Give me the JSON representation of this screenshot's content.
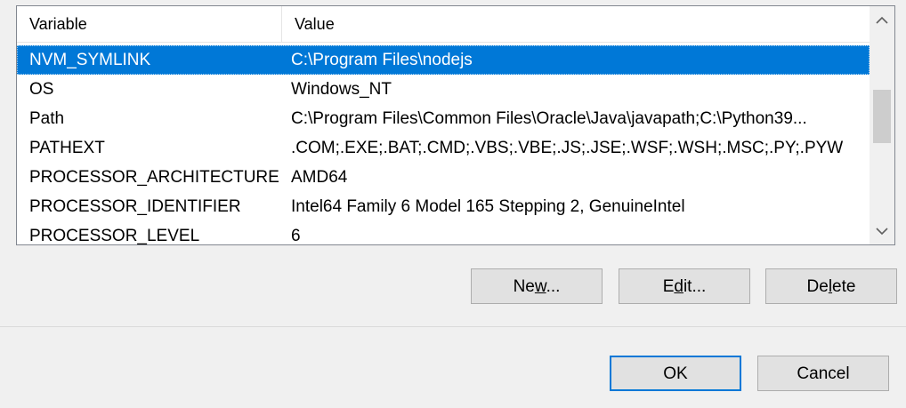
{
  "list": {
    "columns": {
      "variable": "Variable",
      "value": "Value"
    },
    "rows": [
      {
        "variable": "NVM_SYMLINK",
        "value": "C:\\Program Files\\nodejs",
        "selected": true
      },
      {
        "variable": "OS",
        "value": "Windows_NT"
      },
      {
        "variable": "Path",
        "value": "C:\\Program Files\\Common Files\\Oracle\\Java\\javapath;C:\\Python39..."
      },
      {
        "variable": "PATHEXT",
        "value": ".COM;.EXE;.BAT;.CMD;.VBS;.VBE;.JS;.JSE;.WSF;.WSH;.MSC;.PY;.PYW"
      },
      {
        "variable": "PROCESSOR_ARCHITECTURE",
        "value": "AMD64"
      },
      {
        "variable": "PROCESSOR_IDENTIFIER",
        "value": "Intel64 Family 6 Model 165 Stepping 2, GenuineIntel"
      },
      {
        "variable": "PROCESSOR_LEVEL",
        "value": "6"
      }
    ]
  },
  "buttons": {
    "new": {
      "label": "New...",
      "mnemonic_index": 2
    },
    "edit": {
      "label": "Edit...",
      "mnemonic_index": 1
    },
    "delete": {
      "label": "Delete",
      "mnemonic_index": 2
    },
    "ok": "OK",
    "cancel": "Cancel"
  },
  "colors": {
    "selection": "#0078d7",
    "default_button_border": "#0078d7"
  },
  "icons": {
    "scroll_up": "chevron-up-icon",
    "scroll_down": "chevron-down-icon"
  }
}
